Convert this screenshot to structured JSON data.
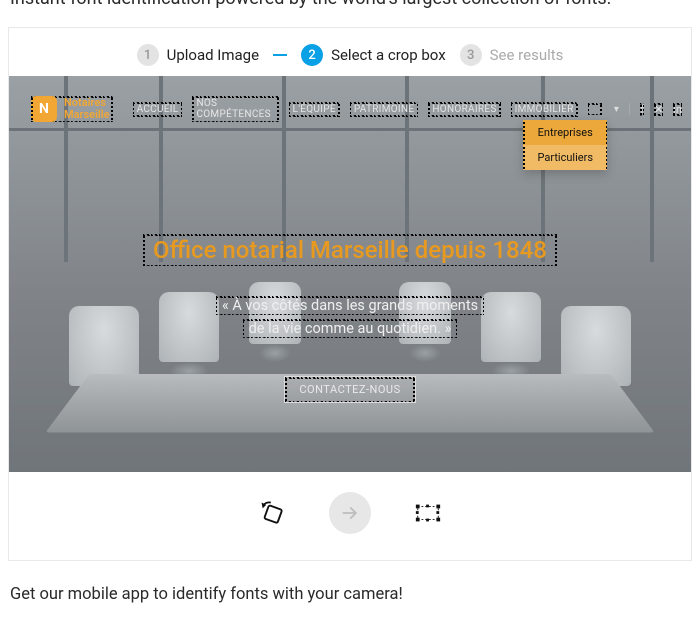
{
  "subtitle_top": "Instant font identification powered by the world's largest collection of fonts.",
  "stepper": {
    "s1": {
      "num": "1",
      "label": "Upload Image"
    },
    "s2": {
      "num": "2",
      "label": "Select a crop box"
    },
    "s3": {
      "num": "3",
      "label": "See results"
    }
  },
  "site": {
    "logo": {
      "line1": "Notaires",
      "line2": "Marseille"
    },
    "nav": {
      "accueil": "ACCUEIL",
      "competences": "NOS COMPÉTENCES",
      "equipe": "L'ÉQUIPE",
      "patrimoine": "PATRIMOINE",
      "honoraires": "HONORAIRES",
      "immobilier": "IMMOBILIER"
    },
    "dropdown": {
      "entreprises": "Entreprises",
      "particuliers": "Particuliers"
    },
    "hero_title": "Office notarial Marseille depuis 1848",
    "hero_sub_line1": "« À vos côtés dans les grands moments",
    "hero_sub_line2": "de la vie comme au quotidien. »",
    "contact_label": "CONTACTEZ-NOUS"
  },
  "footer_note": "Get our mobile app to identify fonts with your camera!"
}
